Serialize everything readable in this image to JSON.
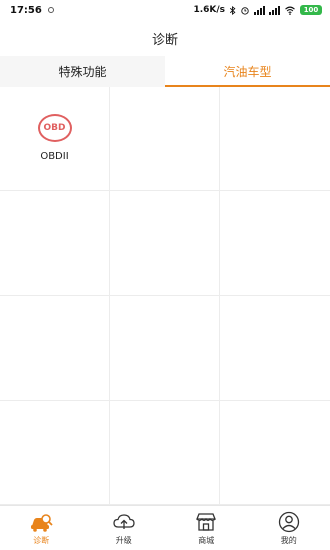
{
  "status_bar": {
    "time": "17:56",
    "speed": "1.6K/s",
    "battery": "100"
  },
  "title": "诊断",
  "tabs": [
    {
      "label": "特殊功能",
      "active": false
    },
    {
      "label": "汽油车型",
      "active": true
    }
  ],
  "grid": {
    "items": [
      {
        "logo": "OBD",
        "label": "OBDII"
      }
    ]
  },
  "bottom_nav": [
    {
      "label": "诊断",
      "icon": "car-diagnosis-icon",
      "active": true
    },
    {
      "label": "升级",
      "icon": "cloud-upgrade-icon",
      "active": false
    },
    {
      "label": "商城",
      "icon": "shop-icon",
      "active": false
    },
    {
      "label": "我的",
      "icon": "user-icon",
      "active": false
    }
  ],
  "colors": {
    "accent": "#e8841c",
    "obd_logo": "#e06060"
  }
}
